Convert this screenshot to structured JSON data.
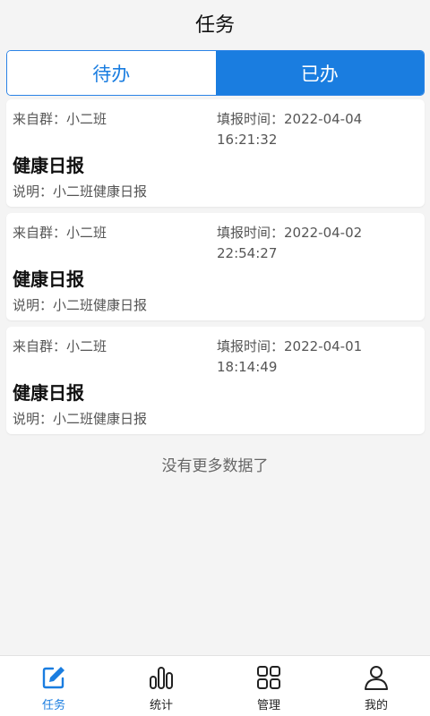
{
  "header": {
    "title": "任务"
  },
  "tabs": {
    "todo_label": "待办",
    "done_label": "已办"
  },
  "cards": [
    {
      "from": "来自群：小二班",
      "time_line1": "填报时间：2022-04-04",
      "time_line2": "16:21:32",
      "title": "健康日报",
      "desc": "说明：小二班健康日报"
    },
    {
      "from": "来自群：小二班",
      "time_line1": "填报时间：2022-04-02",
      "time_line2": "22:54:27",
      "title": "健康日报",
      "desc": "说明：小二班健康日报"
    },
    {
      "from": "来自群：小二班",
      "time_line1": "填报时间：2022-04-01",
      "time_line2": "18:14:49",
      "title": "健康日报",
      "desc": "说明：小二班健康日报"
    }
  ],
  "list_footer": "没有更多数据了",
  "tabbar": {
    "items": [
      {
        "label": "任务",
        "icon": "edit-icon"
      },
      {
        "label": "统计",
        "icon": "bar-chart-icon"
      },
      {
        "label": "管理",
        "icon": "grid-icon"
      },
      {
        "label": "我的",
        "icon": "user-icon"
      }
    ]
  },
  "colors": {
    "accent": "#1a7de0",
    "background": "#f4f4f4"
  }
}
